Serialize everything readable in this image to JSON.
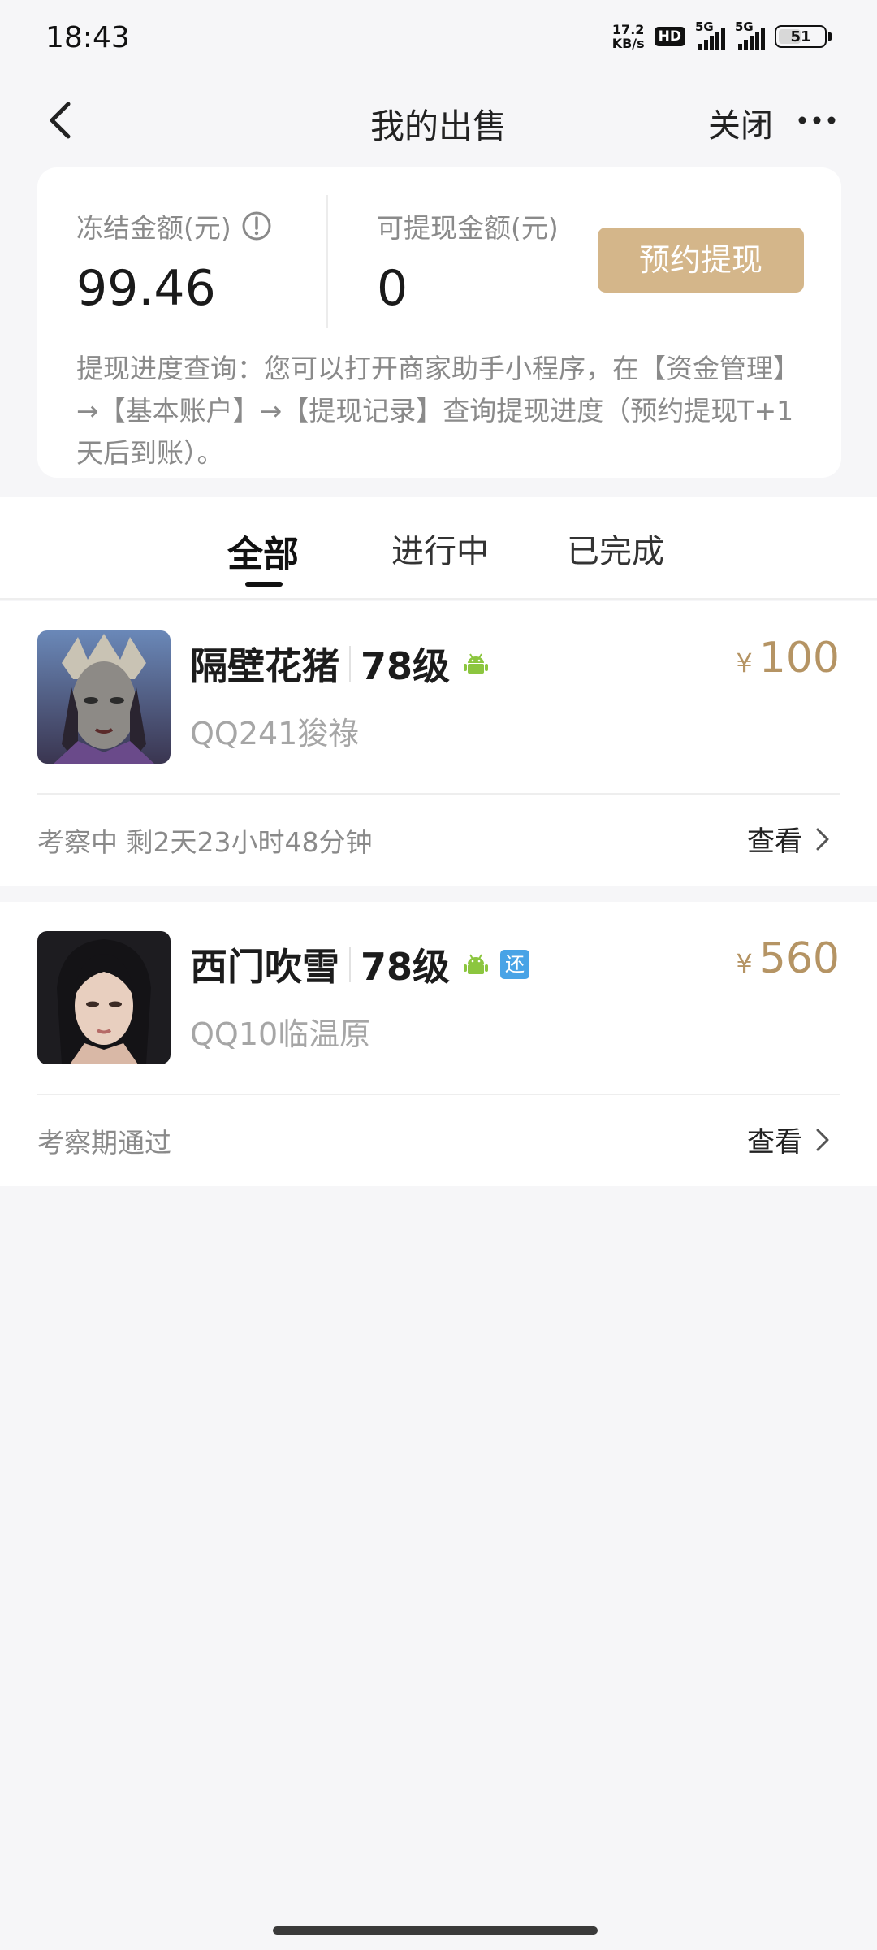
{
  "status_bar": {
    "time": "18:43",
    "net_speed_value": "17.2",
    "net_speed_unit": "KB/s",
    "hd_label": "HD",
    "signal_1_label": "5G",
    "signal_2_label": "5G",
    "battery_level": "51"
  },
  "nav": {
    "title": "我的出售",
    "close_label": "关闭"
  },
  "balance": {
    "frozen_label": "冻结金额(元)",
    "frozen_value": "99.46",
    "withdrawable_label": "可提现金额(元)",
    "withdrawable_value": "0",
    "withdraw_button": "预约提现",
    "note": "提现进度查询：您可以打开商家助手小程序，在【资金管理】→【基本账户】→【提现记录】查询提现进度（预约提现T+1天后到账）。"
  },
  "tabs": [
    {
      "label": "全部",
      "active": true
    },
    {
      "label": "进行中",
      "active": false
    },
    {
      "label": "已完成",
      "active": false
    }
  ],
  "orders": [
    {
      "name": "隔壁花猪",
      "level": "78级",
      "platform_icon": "android-icon",
      "server": "QQ241狻祿",
      "currency": "¥",
      "price": "100",
      "status": "考察中 剩2天23小时48分钟",
      "view_label": "查看"
    },
    {
      "name": "西门吹雪",
      "level": "78级",
      "platform_icon": "android-icon",
      "badge": "还",
      "server": "QQ10临温原",
      "currency": "¥",
      "price": "560",
      "status": "考察期通过",
      "view_label": "查看"
    }
  ],
  "colors": {
    "accent_gold": "#d4b68a",
    "price_gold": "#b59464",
    "badge_blue": "#48a3e6",
    "android_green": "#8cc63f"
  }
}
